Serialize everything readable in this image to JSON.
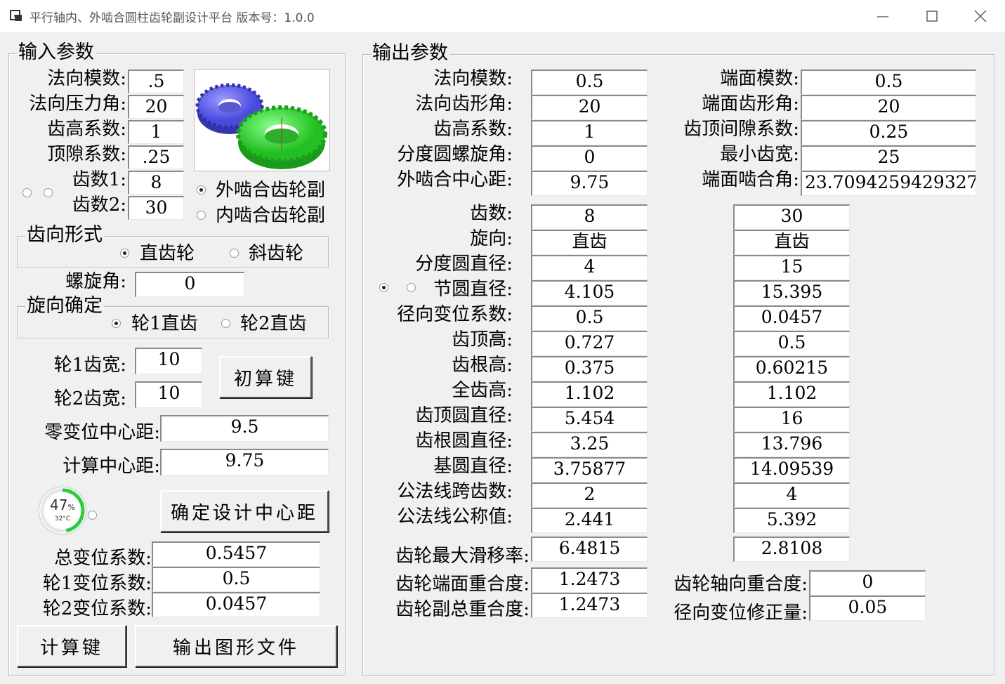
{
  "window": {
    "title": "平行轴内、外啮合圆柱齿轮副设计平台 版本号：1.0.0",
    "min_glyph": "—",
    "max_glyph": "☐",
    "close_glyph": "✕"
  },
  "input": {
    "group_title": "输入参数",
    "fields": [
      {
        "label": "法向模数:",
        "value": ".5"
      },
      {
        "label": "法向压力角:",
        "value": "20"
      },
      {
        "label": "齿高系数:",
        "value": "1"
      },
      {
        "label": "顶隙系数:",
        "value": ".25"
      },
      {
        "label": "齿数1:",
        "value": "8"
      },
      {
        "label": "齿数2:",
        "value": "30"
      }
    ],
    "mesh_options": [
      {
        "label": "外啮合齿轮副",
        "checked": true
      },
      {
        "label": "内啮合齿轮副",
        "checked": false
      }
    ],
    "tooth_form": {
      "title": "齿向形式",
      "options": [
        {
          "label": "直齿轮",
          "checked": true
        },
        {
          "label": "斜齿轮",
          "checked": false
        }
      ]
    },
    "helix_angle": {
      "label": "螺旋角:",
      "value": "0"
    },
    "rotation": {
      "title": "旋向确定",
      "options": [
        {
          "label": "轮1直齿",
          "checked": true
        },
        {
          "label": "轮2直齿",
          "checked": false
        }
      ]
    },
    "width1": {
      "label": "轮1齿宽:",
      "value": "10"
    },
    "width2": {
      "label": "轮2齿宽:",
      "value": "10"
    },
    "initial_calc_button": "初算键",
    "zero_shift_center": {
      "label": "零变位中心距:",
      "value": "9.5"
    },
    "calc_center": {
      "label": "计算中心距:",
      "value": "9.75"
    },
    "confirm_center_button": "确定设计中心距",
    "total_shift": {
      "label": "总变位系数:",
      "value": "0.5457"
    },
    "shift1": {
      "label": "轮1变位系数:",
      "value": "0.5"
    },
    "shift2": {
      "label": "轮2变位系数:",
      "value": "0.0457"
    },
    "calc_button": "计算键",
    "export_button": "输出图形文件"
  },
  "gauge": {
    "percent": "47",
    "unit": "%",
    "temp": "32°C",
    "fraction": 0.47
  },
  "output": {
    "group_title": "输出参数",
    "top_left": [
      {
        "label": "法向模数:",
        "value": "0.5"
      },
      {
        "label": "法向齿形角:",
        "value": "20"
      },
      {
        "label": "齿高系数:",
        "value": "1"
      },
      {
        "label": "分度圆螺旋角:",
        "value": "0"
      },
      {
        "label": "外啮合中心距:",
        "value": "9.75"
      }
    ],
    "top_right": [
      {
        "label": "端面模数:",
        "value": "0.5"
      },
      {
        "label": "端面齿形角:",
        "value": "20"
      },
      {
        "label": "齿顶间隙系数:",
        "value": "0.25"
      },
      {
        "label": "最小齿宽:",
        "value": "25"
      },
      {
        "label": "端面啮合角:",
        "value": "23.7094259429327"
      }
    ],
    "gear_rows": [
      {
        "label": "齿数:",
        "g1": "8",
        "g2": "30"
      },
      {
        "label": "旋向:",
        "g1": "直齿",
        "g2": "直齿"
      },
      {
        "label": "分度圆直径:",
        "g1": "4",
        "g2": "15"
      },
      {
        "label": "节圆直径:",
        "g1": "4.105",
        "g2": "15.395"
      },
      {
        "label": "径向变位系数:",
        "g1": "0.5",
        "g2": "0.0457"
      },
      {
        "label": "齿顶高:",
        "g1": "0.727",
        "g2": "0.5"
      },
      {
        "label": "齿根高:",
        "g1": "0.375",
        "g2": "0.60215"
      },
      {
        "label": "全齿高:",
        "g1": "1.102",
        "g2": "1.102"
      },
      {
        "label": "齿顶圆直径:",
        "g1": "5.454",
        "g2": "16"
      },
      {
        "label": "齿根圆直径:",
        "g1": "3.25",
        "g2": "13.796"
      },
      {
        "label": "基圆直径:",
        "g1": "3.75877",
        "g2": "14.09539"
      },
      {
        "label": "公法线跨齿数:",
        "g1": "2",
        "g2": "4"
      },
      {
        "label": "公法线公称值:",
        "g1": "2.441",
        "g2": "5.392"
      }
    ],
    "max_slip": {
      "label": "齿轮最大滑移率:",
      "g1": "6.4815",
      "g2": "2.8108"
    },
    "transverse_contact": {
      "label": "齿轮端面重合度:",
      "value": "1.2473"
    },
    "total_contact": {
      "label": "齿轮副总重合度:",
      "value": "1.2473"
    },
    "axial_contact": {
      "label": "齿轮轴向重合度:",
      "value": "0"
    },
    "radial_correction": {
      "label": "径向变位修正量:",
      "value": "0.05"
    }
  },
  "colors": {
    "gear1": "#6b6bf0",
    "gear2": "#3ee83e",
    "gauge_arc": "#2ecc40"
  }
}
